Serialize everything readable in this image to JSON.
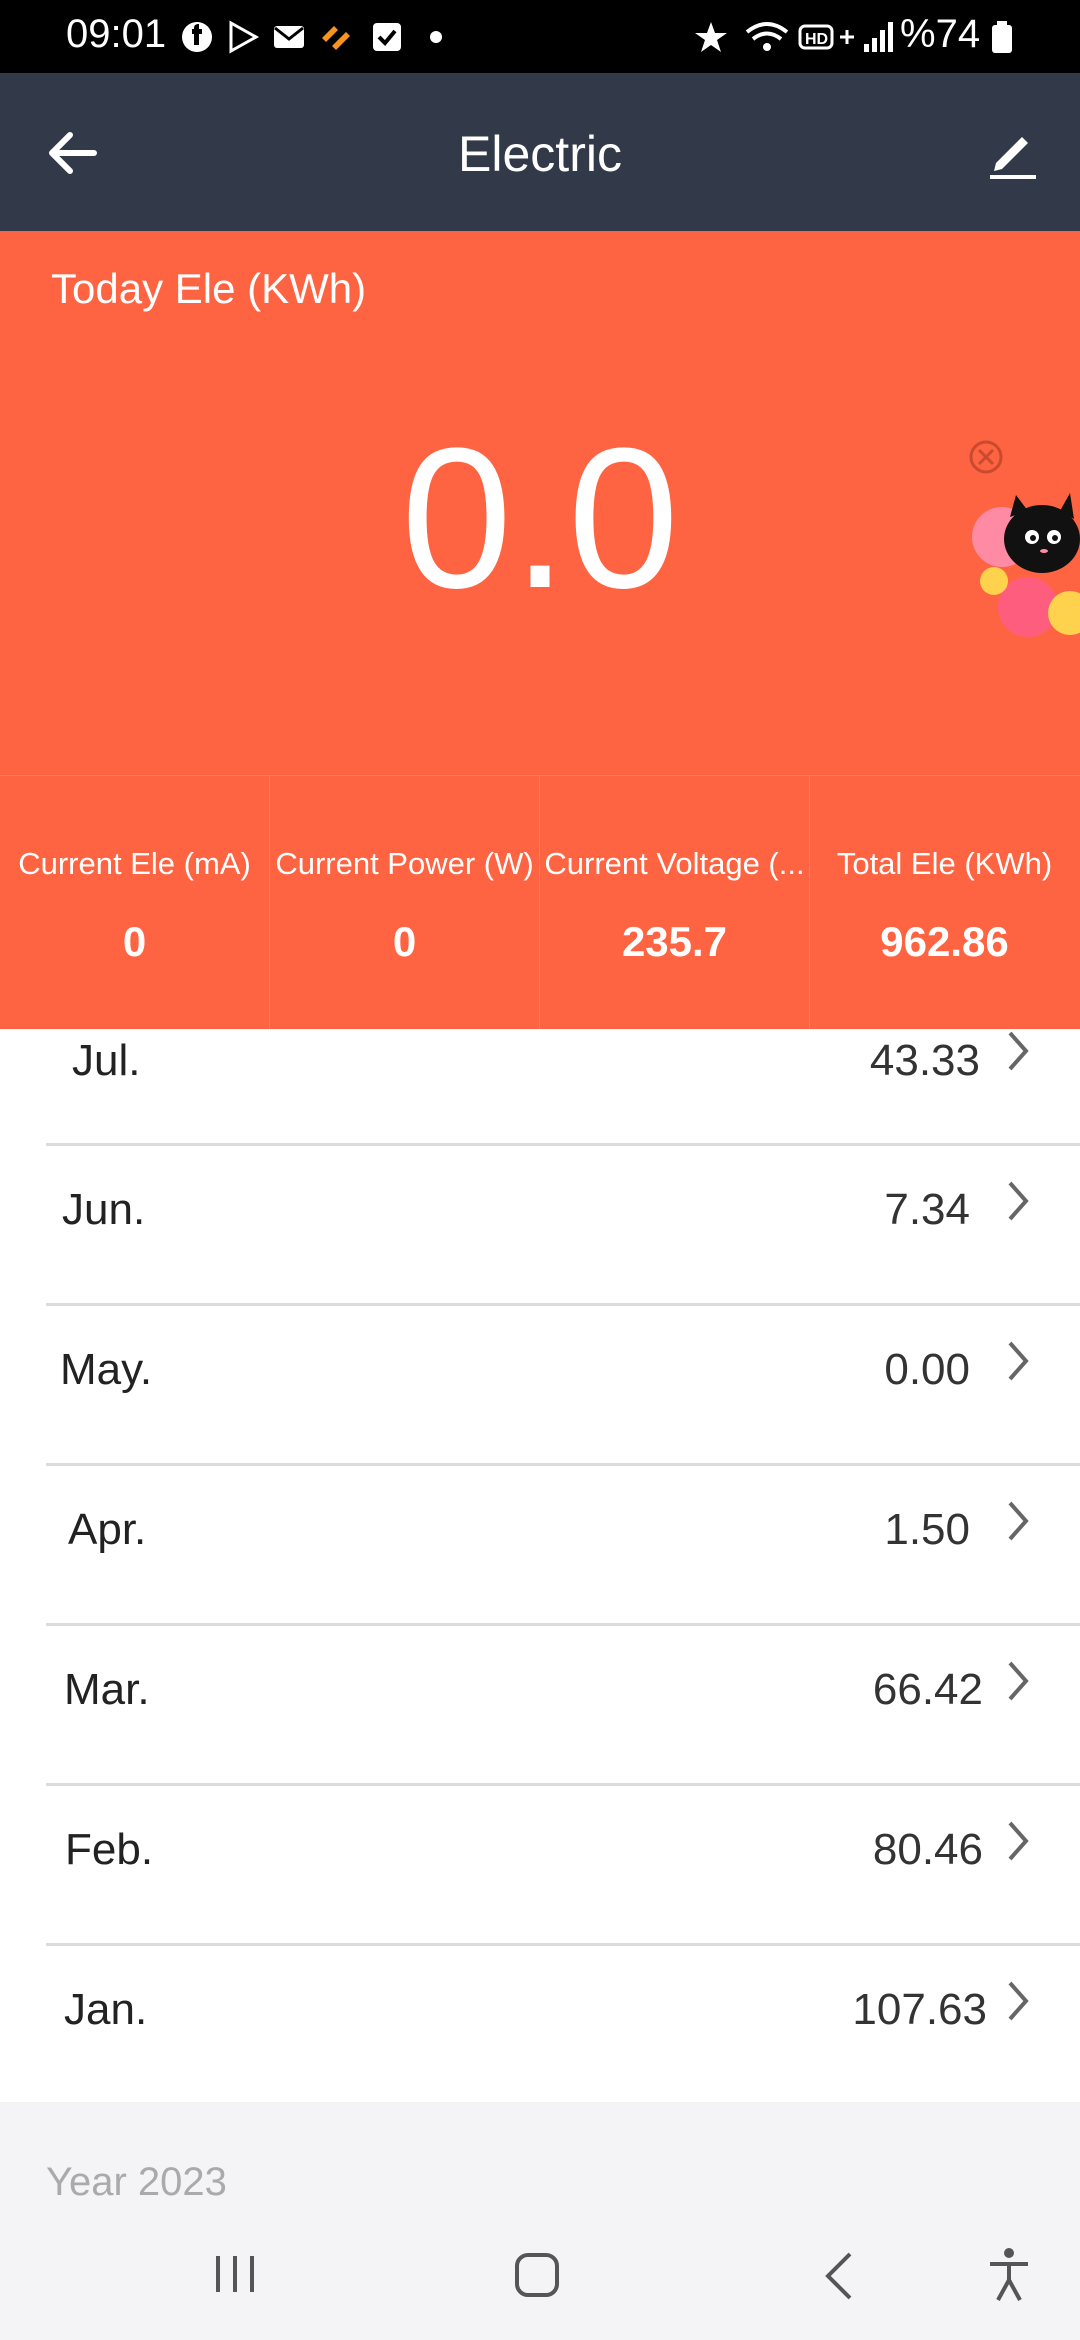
{
  "status_bar": {
    "time": "09:01",
    "battery": "%74"
  },
  "header": {
    "title": "Electric"
  },
  "today": {
    "label": "Today Ele (KWh)",
    "value": "0.0"
  },
  "stats": [
    {
      "label": "Current Ele (mA)",
      "value": "0"
    },
    {
      "label": "Current Power (W)",
      "value": "0"
    },
    {
      "label": "Current Voltage (...",
      "value": "235.7"
    },
    {
      "label": "Total Ele (KWh)",
      "value": "962.86"
    }
  ],
  "months": [
    {
      "label": "Jul.",
      "value": "43.33"
    },
    {
      "label": "Jun.",
      "value": "7.34"
    },
    {
      "label": "May.",
      "value": "0.00"
    },
    {
      "label": "Apr.",
      "value": "1.50"
    },
    {
      "label": "Mar.",
      "value": "66.42"
    },
    {
      "label": "Feb.",
      "value": "80.46"
    },
    {
      "label": "Jan.",
      "value": "107.63"
    }
  ],
  "year_section": "Year 2023",
  "colors": {
    "header_bg": "#323949",
    "accent": "#ff6442"
  },
  "icons": [
    "back-arrow-icon",
    "edit-pencil-icon",
    "chevron-right-icon",
    "promo-cat-icon",
    "close-circle-icon"
  ]
}
